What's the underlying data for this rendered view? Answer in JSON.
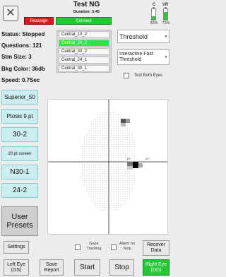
{
  "header": {
    "title": "Test  NG",
    "duration": "Duration: 3:45",
    "left_button": "Reassign",
    "connect_button": "Connect",
    "close_icon": "close-icon"
  },
  "battery": [
    {
      "label": "C",
      "percent": "33%",
      "level": 0.33,
      "color": "#2fc23c"
    },
    {
      "label": "VR",
      "percent": "73%",
      "level": 0.73,
      "color": "#2fc23c"
    }
  ],
  "status": {
    "status": "Status: Stopped",
    "questions": "Questions: 121",
    "stim_size": "Stm Size: 3",
    "bkg_color": "Bkg Color: 36db",
    "speed": "Speed: 0.7Sec"
  },
  "strategies": [
    "Central_10_2",
    "Central_24_2",
    "Central_30_2",
    "Central_24_1",
    "Central_30_1"
  ],
  "selected_strategy": 1,
  "dropdowns": {
    "threshold": "Threshold",
    "algorithm": "Interactive Fast Threshold"
  },
  "test_both_eyes": "Test Both Eyes",
  "left_buttons": [
    "Superior_50",
    "Ptosis 9 pt",
    "30-2",
    "20 pt screen",
    "N30-1",
    "24-2"
  ],
  "user_presets": "User Presets",
  "field": {
    "scale_labels": [
      "10°",
      "20°"
    ]
  },
  "options": {
    "gaze_tracking": "Gaze Tracking",
    "alarm_on_stop": "Alarm on Stop"
  },
  "bottom": {
    "settings": "Settings",
    "recover": "Recover Data",
    "left_eye": "Left Eye (OS)",
    "save_report": "Save Report",
    "start": "Start",
    "stop": "Stop",
    "right_eye": "Right Eye (OD)"
  },
  "colors": {
    "red": "#d21e1e",
    "green": "#22c733",
    "selected": "#2ae83d",
    "preset_blue": "#cdeef0"
  }
}
